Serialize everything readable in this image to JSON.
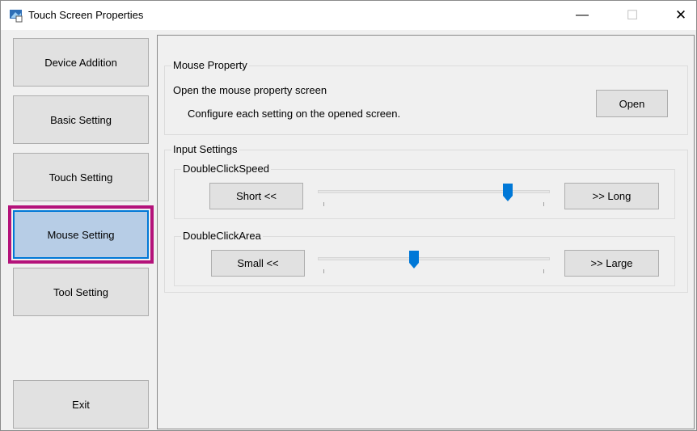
{
  "window": {
    "title": "Touch Screen Properties",
    "minimize": "—",
    "maximize": "☐",
    "close": "✕"
  },
  "sidebar": {
    "items": [
      {
        "label": "Device Addition"
      },
      {
        "label": "Basic Setting"
      },
      {
        "label": "Touch Setting"
      },
      {
        "label": "Mouse Setting",
        "selected": true
      },
      {
        "label": "Tool Setting"
      }
    ],
    "exit_label": "Exit"
  },
  "mouse_property": {
    "title": "Mouse Property",
    "description": "Open the mouse property screen",
    "hint": "Configure each setting on the opened screen.",
    "open_label": "Open"
  },
  "input_settings": {
    "title": "Input Settings",
    "double_click_speed": {
      "title": "DoubleClickSpeed",
      "left_label": "Short <<",
      "right_label": ">> Long",
      "value_fraction": 0.84
    },
    "double_click_area": {
      "title": "DoubleClickArea",
      "left_label": "Small <<",
      "right_label": ">> Large",
      "value_fraction": 0.41
    }
  },
  "colors": {
    "accent": "#0078d7",
    "highlight": "#b4127a",
    "selected_bg": "#b7cde6"
  }
}
